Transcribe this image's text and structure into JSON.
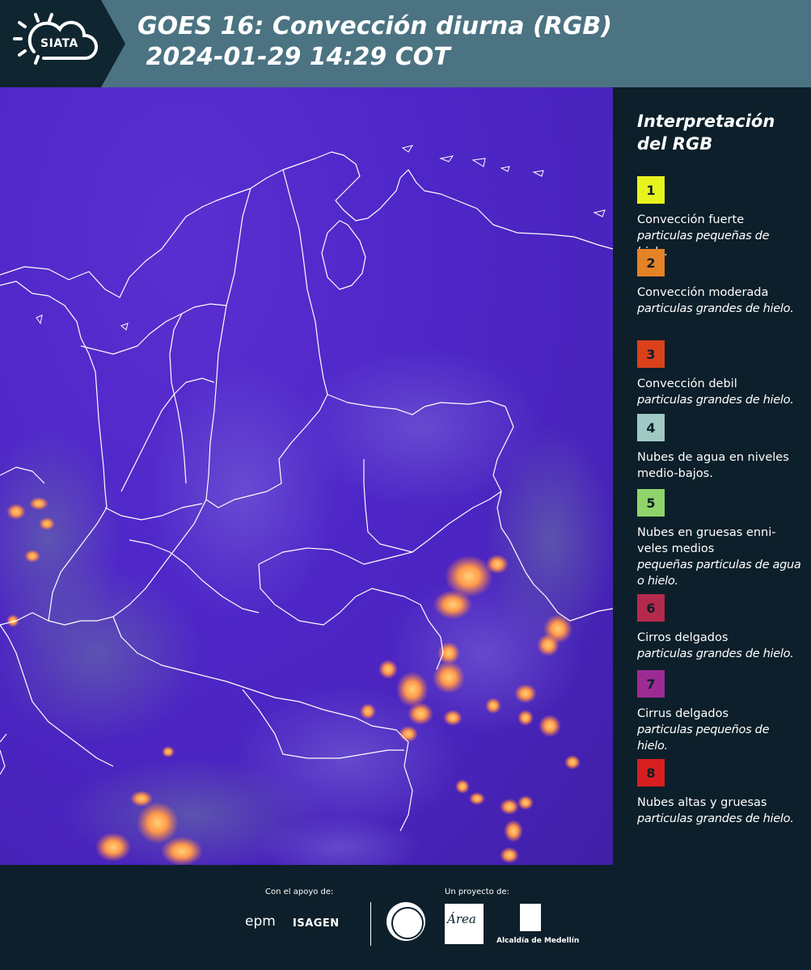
{
  "header": {
    "logo_text": "SIATA",
    "title": "GOES 16: Convección diurna (RGB)\n 2024-01-29 14:29 COT"
  },
  "legend": {
    "title": "Interpretación del RGB",
    "items": [
      {
        "number": "1",
        "color": "#e8f21c",
        "main": "Convección fuerte",
        "sub": "particulas pequeñas de hielo."
      },
      {
        "number": "2",
        "color": "#e58226",
        "main": "Convección moderada",
        "sub": "particulas grandes de hielo."
      },
      {
        "number": "3",
        "color": "#d9411c",
        "main": "Convección debil",
        "sub": "particulas grandes de hielo."
      },
      {
        "number": "4",
        "color": "#9fc9c4",
        "main": "Nubes de agua en niveles medio-bajos.",
        "sub": ""
      },
      {
        "number": "5",
        "color": "#8fd46a",
        "main": "Nubes en gruesas enni-veles medios",
        "sub": "pequeñas particulas de agua o hielo."
      },
      {
        "number": "6",
        "color": "#b42a4c",
        "main": "Cirros delgados",
        "sub": "particulas grandes de hielo."
      },
      {
        "number": "7",
        "color": "#9c2b94",
        "main": "Cirrus delgados",
        "sub": "particulas pequeños de hielo."
      },
      {
        "number": "8",
        "color": "#d81f1f",
        "main": "Nubes altas y gruesas",
        "sub": "particulas grandes de hielo."
      }
    ]
  },
  "footer": {
    "support_label": "Con el apoyo de:",
    "project_label": "Un proyecto de:",
    "epm": "epm",
    "isagen": "ISAGEN",
    "area_text": "Área",
    "alcaldia": "Alcaldía de Medellín"
  },
  "colors": {
    "header_bg": "#4b7382",
    "dark_bg": "#0c1f2a",
    "map_base": "#4f26c8"
  }
}
